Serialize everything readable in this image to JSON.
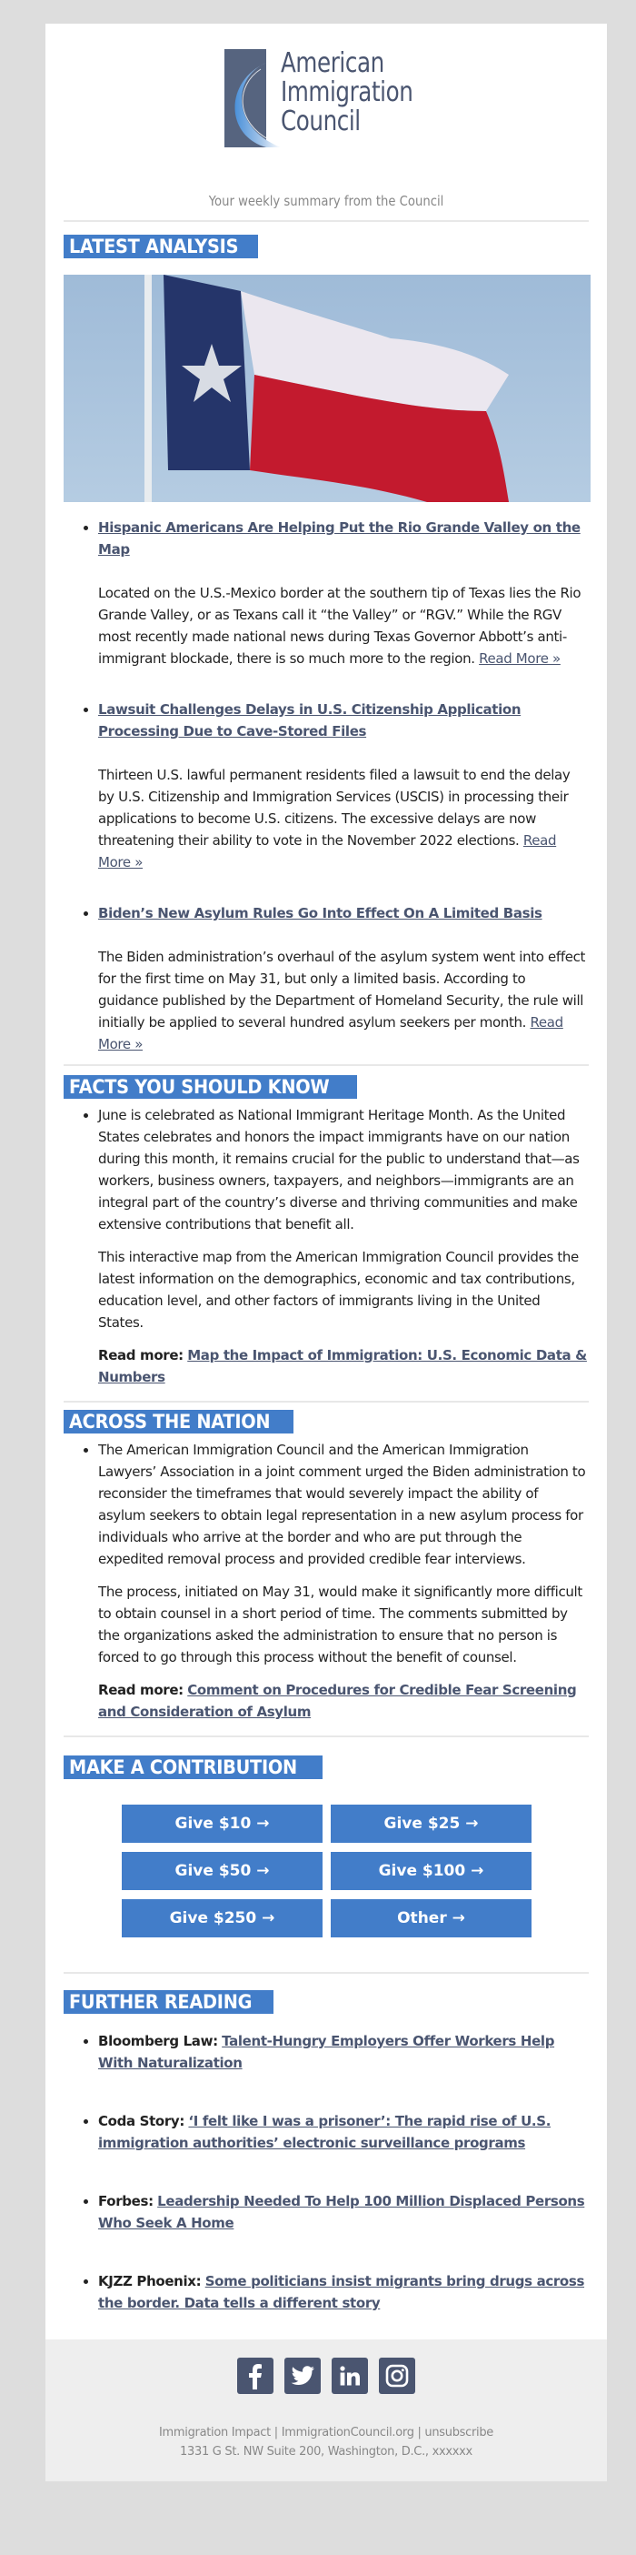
{
  "header": {
    "logo_lines": [
      "American",
      "Immigration",
      "Council"
    ],
    "tagline": "Your weekly summary from the Council"
  },
  "colors": {
    "accent": "#427dc9",
    "link": "#4a5570",
    "page_bg": "#dddddd",
    "footer_bg": "#eeeeee"
  },
  "latest_analysis": {
    "heading": "LATEST ANALYSIS",
    "hero_image_alt": "Texas state flag waving on a flagpole",
    "articles": [
      {
        "title": "Hispanic Americans Are Helping Put the Rio Grande Valley on the Map",
        "summary": "Located on the U.S.-Mexico border at the southern tip of Texas lies the Rio Grande Valley, or as Texans call it “the Valley” or “RGV.” While the RGV most recently made national news during Texas Governor Abbott’s anti-immigrant blockade, there is so much more to the region.",
        "read_more": "Read More »"
      },
      {
        "title": "Lawsuit Challenges Delays in U.S. Citizenship Application Processing Due to Cave-Stored Files",
        "summary": "Thirteen U.S. lawful permanent residents filed a lawsuit to end the delay by U.S. Citizenship and Immigration Services (USCIS) in processing their applications to become U.S. citizens. The excessive delays are now threatening their ability to vote in the November 2022 elections.",
        "read_more": "Read More »"
      },
      {
        "title": "Biden’s New Asylum Rules Go Into Effect On A Limited Basis",
        "summary": "The Biden administration’s overhaul of the asylum system went into effect for the first time on May 31, but only a limited basis. According to guidance published by the Department of Homeland Security, the rule will initially be applied to several hundred asylum seekers per month.",
        "read_more": "Read More »"
      }
    ]
  },
  "facts": {
    "heading": "FACTS YOU SHOULD KNOW",
    "paragraph1": "June is celebrated as National Immigrant Heritage Month. As the United States celebrates and honors the impact immigrants have on our nation during this month, it remains crucial for the public to understand that—as workers, business owners, taxpayers, and neighbors—immigrants are an integral part of the country’s diverse and thriving communities and make extensive contributions that benefit all.",
    "paragraph2": "This interactive map from the American Immigration Council provides the latest information on the demographics, economic and tax contributions, education level, and other factors of immigrants living in the United States.",
    "read_more_label": "Read more:",
    "read_more_link": "Map the Impact of Immigration: U.S. Economic Data & Numbers"
  },
  "nation": {
    "heading": "ACROSS THE NATION",
    "paragraph1": "The American Immigration Council and the American Immigration Lawyers’ Association in a joint comment urged the Biden administration to reconsider the timeframes that would severely impact the ability of asylum seekers to obtain legal representation in a new asylum process for individuals who arrive at the border and who are put through the expedited removal process and provided credible fear interviews.",
    "paragraph2": "The process, initiated on May 31, would make it significantly more difficult to obtain counsel in a short period of time. The comments submitted by the organizations asked the administration to ensure that no person is forced to go through this process without the benefit of counsel.",
    "read_more_label": "Read more:",
    "read_more_link": "Comment on Procedures for Credible Fear Screening and Consideration of Asylum"
  },
  "contribution": {
    "heading": "MAKE A CONTRIBUTION",
    "buttons": [
      "Give $10 →",
      "Give $25 →",
      "Give $50 →",
      "Give $100 →",
      "Give $250 →",
      "Other →"
    ]
  },
  "further_reading": {
    "heading": "FURTHER READING",
    "items": [
      {
        "source": "Bloomberg Law:",
        "title": "Talent-Hungry Employers Offer Workers Help With Naturalization"
      },
      {
        "source": "Coda Story:",
        "title": "‘I felt like I was a prisoner’: The rapid rise of U.S. immigration authorities’ electronic surveillance programs"
      },
      {
        "source": "Forbes:",
        "title": "Leadership Needed To Help 100 Million Displaced Persons Who Seek A Home"
      },
      {
        "source": "KJZZ Phoenix:",
        "title": "Some politicians insist migrants bring drugs across the border. Data tells a different story"
      }
    ]
  },
  "footer": {
    "social_icons": [
      "facebook-icon",
      "twitter-icon",
      "linkedin-icon",
      "instagram-icon"
    ],
    "links": [
      "Immigration Impact",
      "ImmigrationCouncil.org",
      "unsubscribe"
    ],
    "separator": " | ",
    "address": "1331 G St. NW Suite 200, Washington, D.C., xxxxxx"
  }
}
